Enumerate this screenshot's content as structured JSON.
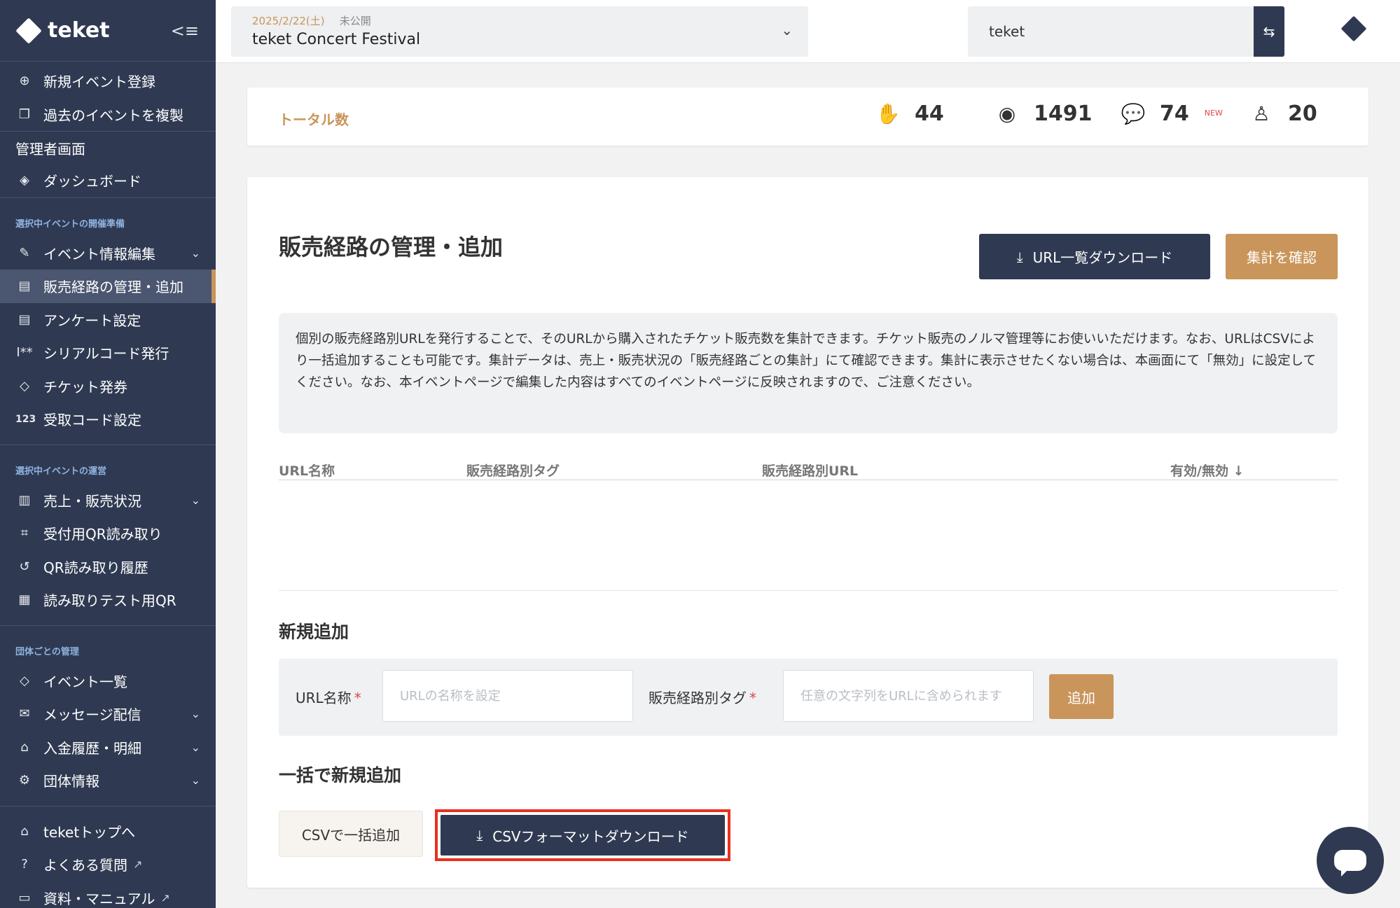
{
  "sidebar": {
    "brand": "teket",
    "items_top": [
      {
        "label": "新規イベント登録",
        "icon": "plus-circle-icon"
      },
      {
        "label": "過去のイベントを複製",
        "icon": "copy-icon"
      }
    ],
    "admin_label": "管理者画面",
    "dashboard": {
      "label": "ダッシュボード",
      "icon": "layers-icon"
    },
    "section1": {
      "title": "選択中イベントの開催準備",
      "items": [
        {
          "label": "イベント情報編集",
          "icon": "edit-icon"
        },
        {
          "label": "販売経路の管理・追加",
          "icon": "document-icon"
        },
        {
          "label": "アンケート設定",
          "icon": "document-icon"
        },
        {
          "label": "シリアルコード発行",
          "icon": "serial-icon"
        },
        {
          "label": "チケット発券",
          "icon": "ticket-icon"
        },
        {
          "label": "受取コード設定",
          "icon": "123"
        }
      ]
    },
    "section2": {
      "title": "選択中イベントの運営",
      "items": [
        {
          "label": "売上・販売状況",
          "icon": "bar-chart-icon"
        },
        {
          "label": "受付用QR読み取り",
          "icon": "scan-icon"
        },
        {
          "label": "QR読み取り履歴",
          "icon": "history-icon"
        },
        {
          "label": "読み取りテスト用QR",
          "icon": "qr-icon"
        }
      ]
    },
    "section3": {
      "title": "団体ごとの管理",
      "items": [
        {
          "label": "イベント一覧",
          "icon": "tag-icon"
        },
        {
          "label": "メッセージ配信",
          "icon": "mail-icon"
        },
        {
          "label": "入金履歴・明細",
          "icon": "bank-icon"
        },
        {
          "label": "団体情報",
          "icon": "gear-icon"
        }
      ]
    },
    "bottom": [
      {
        "label": "teketトップへ",
        "icon": "home-icon"
      },
      {
        "label": "よくある質問",
        "icon": "question-icon"
      },
      {
        "label": "資料・マニュアル",
        "icon": "book-icon"
      }
    ]
  },
  "topbar": {
    "event_date": "2025/2/22(土)",
    "event_status": "未公開",
    "event_name": "teket Concert Festival",
    "org_name": "teket"
  },
  "stats": {
    "label": "トータル数",
    "clap": "44",
    "views": "1491",
    "comments": "74",
    "comments_badge": "NEW",
    "users": "20"
  },
  "main": {
    "title": "販売経路の管理・追加",
    "download_button": "URL一覧ダウンロード",
    "aggregate_button": "集計を確認",
    "info": "個別の販売経路別URLを発行することで、そのURLから購入されたチケット販売数を集計できます。チケット販売のノルマ管理等にお使いいただけます。なお、URLはCSVにより一括追加することも可能です。集計データは、売上・販売状況の「販売経路ごとの集計」にて確認できます。集計に表示させたくない場合は、本画面にて「無効」に設定してください。なお、本イベントページで編集した内容はすべてのイベントページに反映されますので、ご注意ください。",
    "table_headers": [
      "URL名称",
      "販売経路別タグ",
      "販売経路別URL",
      "有効/無効 ↓"
    ],
    "new_add": {
      "title": "新規追加",
      "url_name_label": "URL名称",
      "url_name_placeholder": "URLの名称を設定",
      "tag_label": "販売経路別タグ",
      "tag_placeholder": "任意の文字列をURLに含められます",
      "add_button": "追加"
    },
    "bulk_add": {
      "title": "一括で新規追加",
      "csv_add_button": "CSVで一括追加",
      "csv_format_button": "CSVフォーマットダウンロード"
    }
  }
}
